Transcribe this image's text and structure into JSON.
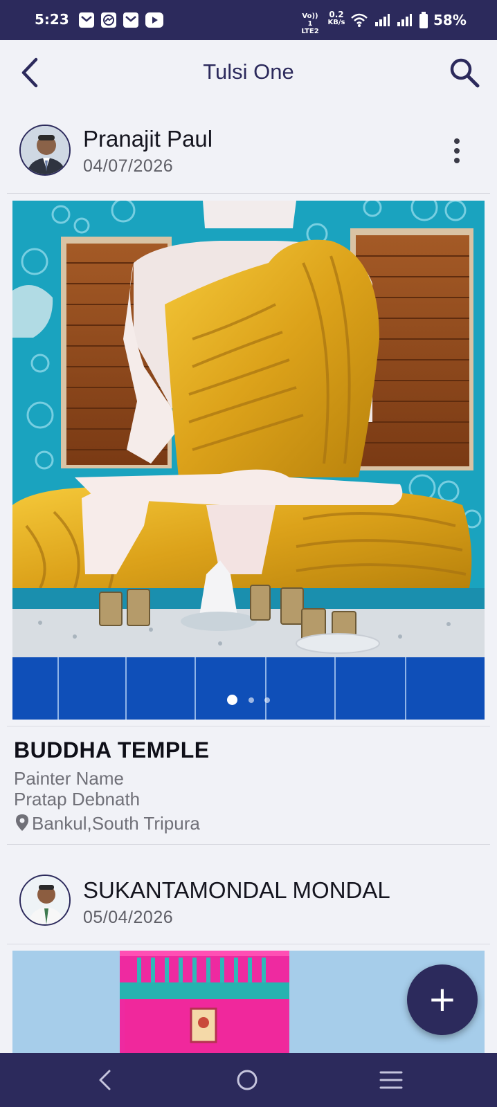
{
  "status_bar": {
    "time": "5:23",
    "network_top": "Vo)) 1",
    "network_bottom": "LTE2",
    "speed_value": "0.2",
    "speed_unit": "KB/s",
    "battery": "58%",
    "notification_icons": [
      "mail-icon",
      "messenger-icon",
      "mail-icon",
      "youtube-icon"
    ]
  },
  "app_bar": {
    "title": "Tulsi One",
    "back_icon": "back-arrow-icon",
    "search_icon": "search-icon"
  },
  "posts": [
    {
      "author": "Pranajit Paul",
      "date": "04/07/2026",
      "title": "BUDDHA TEMPLE",
      "painter_label": "Painter Name",
      "painter_name": "Pratap Debnath",
      "location": "Bankul,South Tripura",
      "carousel_index": 1,
      "carousel_count": 3
    },
    {
      "author": "SUKANTAMONDAL MONDAL",
      "date": "05/04/2026"
    }
  ],
  "fab": {
    "label": "+"
  },
  "nav_bar": {
    "icons": [
      "back-nav-icon",
      "home-nav-icon",
      "recents-nav-icon"
    ]
  },
  "colors": {
    "primary": "#2c2a5c",
    "background": "#f1f2f7",
    "accent_gold": "#e0a820",
    "wall_teal": "#1aa3bf"
  }
}
